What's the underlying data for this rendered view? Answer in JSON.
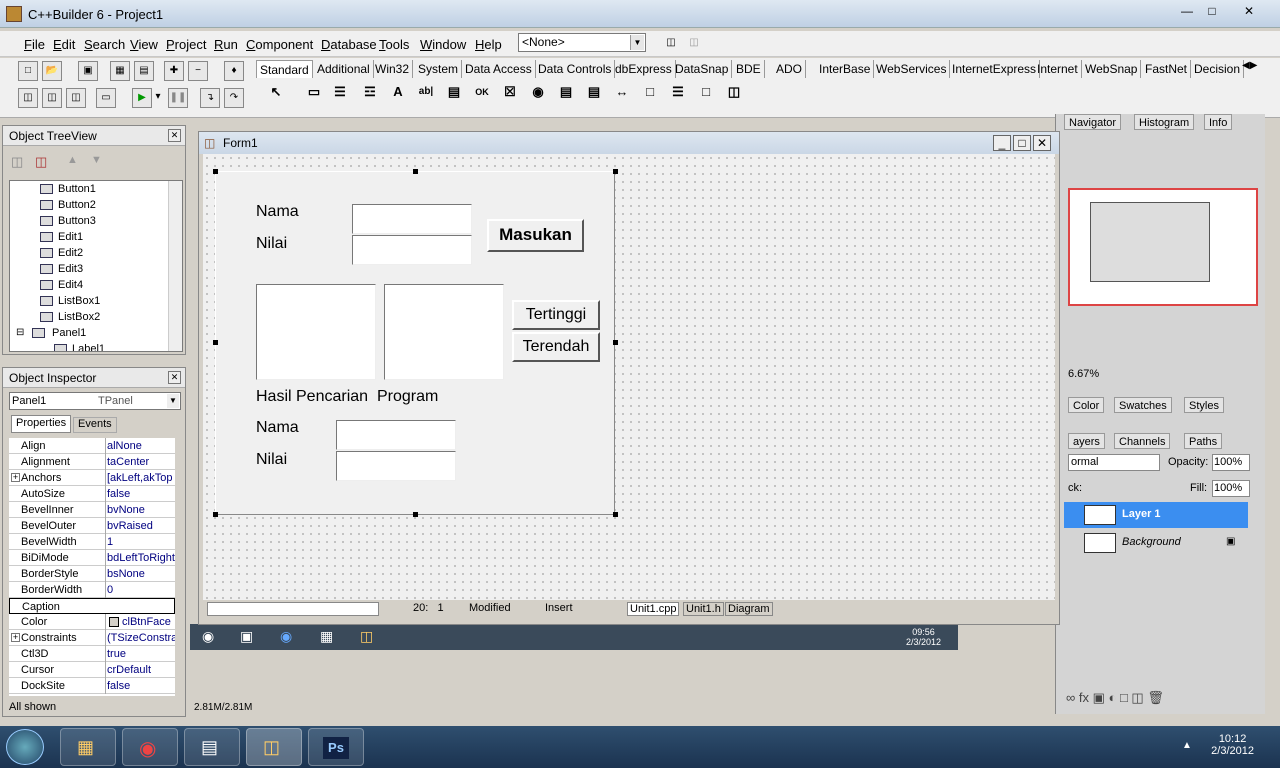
{
  "app": {
    "title": "C++Builder 6 - Project1"
  },
  "menu": [
    "File",
    "Edit",
    "Search",
    "View",
    "Project",
    "Run",
    "Component",
    "Database",
    "Tools",
    "Window",
    "Help"
  ],
  "menu_u": [
    "F",
    "E",
    "S",
    "V",
    "P",
    "R",
    "C",
    "D",
    "T",
    "W",
    "H"
  ],
  "toolbar": {
    "combo_value": "<None>"
  },
  "palette_tabs": [
    "Standard",
    "Additional",
    "Win32",
    "System",
    "Data Access",
    "Data Controls",
    "dbExpress",
    "DataSnap",
    "BDE",
    "ADO",
    "InterBase",
    "WebServices",
    "InternetExpress",
    "Internet",
    "WebSnap",
    "FastNet",
    "Decision"
  ],
  "treeview": {
    "title": "Object TreeView",
    "items": [
      "Button1",
      "Button2",
      "Button3",
      "Edit1",
      "Edit2",
      "Edit3",
      "Edit4",
      "ListBox1",
      "ListBox2",
      "Panel1",
      "Label1"
    ]
  },
  "inspector": {
    "title": "Object Inspector",
    "object": "Panel1",
    "type": "TPanel",
    "tab_properties": "Properties",
    "tab_events": "Events",
    "props": [
      {
        "k": "Align",
        "v": "alNone"
      },
      {
        "k": "Alignment",
        "v": "taCenter"
      },
      {
        "k": "Anchors",
        "v": "[akLeft,akTop",
        "plus": true
      },
      {
        "k": "AutoSize",
        "v": "false"
      },
      {
        "k": "BevelInner",
        "v": "bvNone"
      },
      {
        "k": "BevelOuter",
        "v": "bvRaised"
      },
      {
        "k": "BevelWidth",
        "v": "1"
      },
      {
        "k": "BiDiMode",
        "v": "bdLeftToRight"
      },
      {
        "k": "BorderStyle",
        "v": "bsNone"
      },
      {
        "k": "BorderWidth",
        "v": "0"
      },
      {
        "k": "Caption",
        "v": ""
      },
      {
        "k": "Color",
        "v": "clBtnFace"
      },
      {
        "k": "Constraints",
        "v": "(TSizeConstra",
        "plus": true
      },
      {
        "k": "Ctl3D",
        "v": "true"
      },
      {
        "k": "Cursor",
        "v": "crDefault"
      },
      {
        "k": "DockSite",
        "v": "false"
      }
    ],
    "footer": "All shown"
  },
  "form": {
    "title": "Form1",
    "labels": {
      "nama1": "Nama",
      "nilai1": "Nilai",
      "hasil": "Hasil Pencarian  Program",
      "nama2": "Nama",
      "nilai2": "Nilai"
    },
    "buttons": {
      "masukan": "Masukan",
      "tertinggi": "Tertinggi",
      "terendah": "Terendah"
    },
    "status": {
      "pos": "20:   1",
      "modified": "Modified",
      "insert": "Insert",
      "tab1": "Unit1.cpp",
      "tab2": "Unit1.h",
      "tab3": "Diagram"
    }
  },
  "photoshop": {
    "tabs_top": [
      "Navigator",
      "Histogram",
      "Info"
    ],
    "zoom": "6.67%",
    "tabs_mid": [
      "Color",
      "Swatches",
      "Styles"
    ],
    "tabs_layers": [
      "ayers",
      "Channels",
      "Paths"
    ],
    "blend": "ormal",
    "opacity_label": "Opacity:",
    "opacity": "100%",
    "lock_label": "ck:",
    "fill_label": "Fill:",
    "fill": "100%",
    "layers": [
      "Layer 1",
      "Background"
    ],
    "doc_size": "2.81M/2.81M"
  },
  "tray": {
    "time": "10:12",
    "date": "2/3/2012",
    "inner_time": "09:56",
    "inner_date": "2/3/2012"
  }
}
